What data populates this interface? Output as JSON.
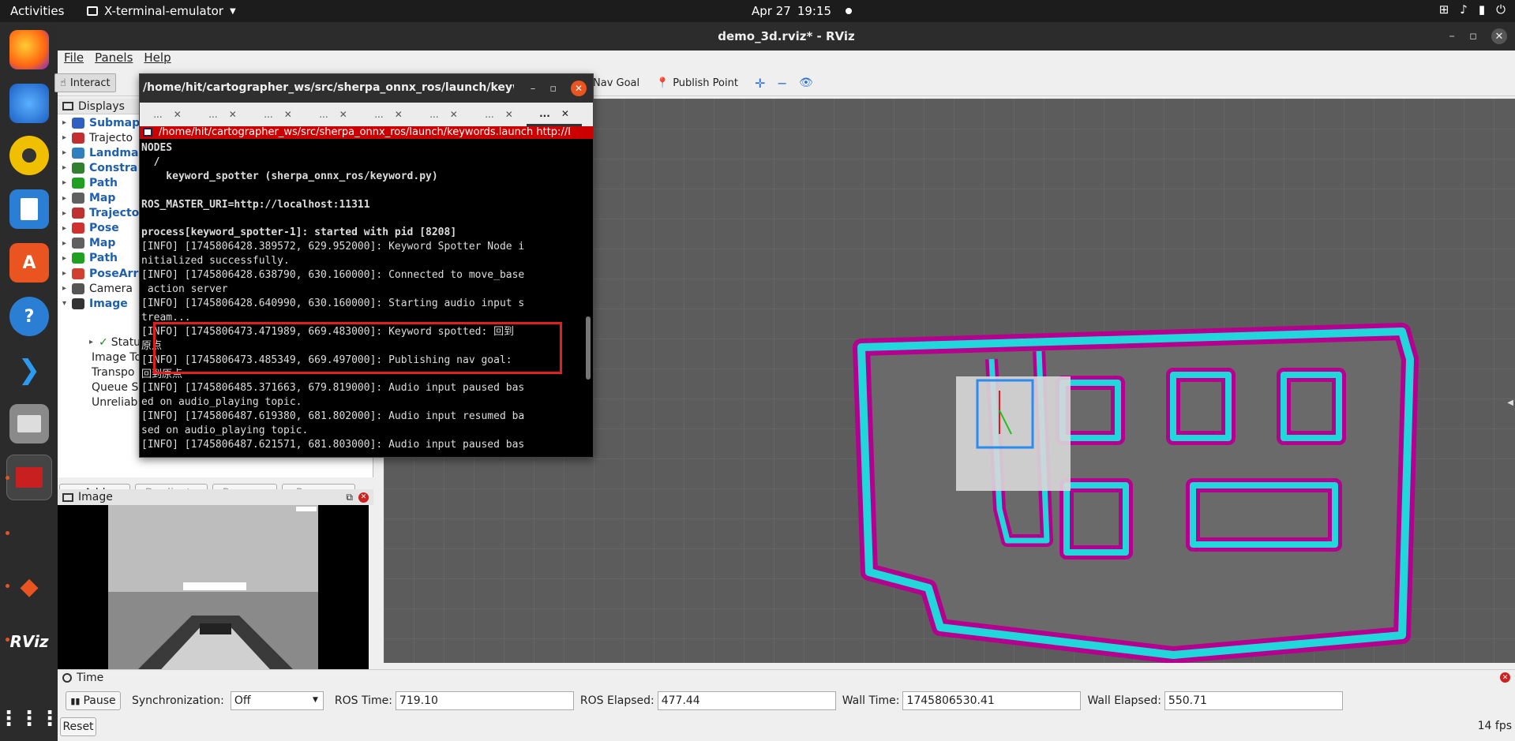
{
  "topbar": {
    "activities": "Activities",
    "app_menu": "X-terminal-emulator",
    "date": "Apr 27",
    "time": "19:15"
  },
  "dock": {
    "items": [
      "firefox-icon",
      "thunderbird-icon",
      "rhythmbox-icon",
      "writer-icon",
      "software-center-icon",
      "help-icon",
      "vscode-icon",
      "files-icon",
      "terminal-icon",
      "layers-icon",
      "rviz-icon",
      "apps-grid-icon"
    ],
    "rviz_label": "RViz"
  },
  "rviz": {
    "window_title": "demo_3d.rviz* - RViz",
    "menu": [
      "File",
      "Panels",
      "Help"
    ],
    "toolbar": {
      "interact": "Interact",
      "nav_goal": "Nav Goal",
      "publish_point": "Publish Point"
    },
    "displays": {
      "title": "Displays",
      "items": [
        {
          "label": "Submap",
          "blue": true,
          "arrow": "▸"
        },
        {
          "label": "Trajecto",
          "blue": false,
          "arrow": "▸"
        },
        {
          "label": "Landma",
          "blue": true,
          "arrow": "▸"
        },
        {
          "label": "Constra",
          "blue": true,
          "arrow": "▸"
        },
        {
          "label": "Path",
          "blue": true,
          "arrow": "▸"
        },
        {
          "label": "Map",
          "blue": true,
          "arrow": "▸"
        },
        {
          "label": "Trajecto",
          "blue": true,
          "arrow": "▸"
        },
        {
          "label": "Pose",
          "blue": true,
          "arrow": "▸"
        },
        {
          "label": "Map",
          "blue": true,
          "arrow": "▸"
        },
        {
          "label": "Path",
          "blue": true,
          "arrow": "▸"
        },
        {
          "label": "PoseArr",
          "blue": true,
          "arrow": "▸"
        },
        {
          "label": "Camera",
          "blue": false,
          "arrow": "▸"
        },
        {
          "label": "Image",
          "blue": true,
          "arrow": "▾"
        }
      ],
      "image_children": [
        "Statu",
        "Image To",
        "Transpo",
        "Queue S",
        "Unreliab"
      ],
      "buttons": {
        "add": "Add",
        "duplicate": "Duplicate",
        "remove": "Remove",
        "rename": "Rename"
      }
    },
    "image_panel": {
      "title": "Image"
    },
    "time_panel": {
      "title": "Time",
      "pause": "Pause",
      "sync_label": "Synchronization:",
      "sync_value": "Off",
      "ros_time_label": "ROS Time:",
      "ros_time": "719.10",
      "ros_elapsed_label": "ROS Elapsed:",
      "ros_elapsed": "477.44",
      "wall_time_label": "Wall Time:",
      "wall_time": "1745806530.41",
      "wall_elapsed_label": "Wall Elapsed:",
      "wall_elapsed": "550.71",
      "reset": "Reset",
      "fps": "14 fps"
    }
  },
  "terminal": {
    "title": "/home/hit/cartographer_ws/src/sherpa_onnx_ros/launch/keywo...",
    "tabs": [
      "...",
      "...",
      "...",
      "...",
      "...",
      "...",
      "...",
      "..."
    ],
    "inner_title": "/home/hit/cartographer_ws/src/sherpa_onnx_ros/launch/keywords.launch http://l",
    "lines": [
      "NODES",
      "  /",
      "    keyword_spotter (sherpa_onnx_ros/keyword.py)",
      "",
      "ROS_MASTER_URI=http://localhost:11311",
      "",
      "process[keyword_spotter-1]: started with pid [8208]",
      "[INFO] [1745806428.389572, 629.952000]: Keyword Spotter Node i",
      "nitialized successfully.",
      "[INFO] [1745806428.638790, 630.160000]: Connected to move_base",
      " action server",
      "[INFO] [1745806428.640990, 630.160000]: Starting audio input s",
      "tream...",
      "[INFO] [1745806473.471989, 669.483000]: Keyword spotted: 回到",
      "原点",
      "[INFO] [1745806473.485349, 669.497000]: Publishing nav goal:",
      "回到原点",
      "[INFO] [1745806485.371663, 679.819000]: Audio input paused bas",
      "ed on audio_playing topic.",
      "[INFO] [1745806487.619380, 681.802000]: Audio input resumed ba",
      "sed on audio_playing topic.",
      "[INFO] [1745806487.621571, 681.803000]: Audio input paused bas"
    ]
  }
}
